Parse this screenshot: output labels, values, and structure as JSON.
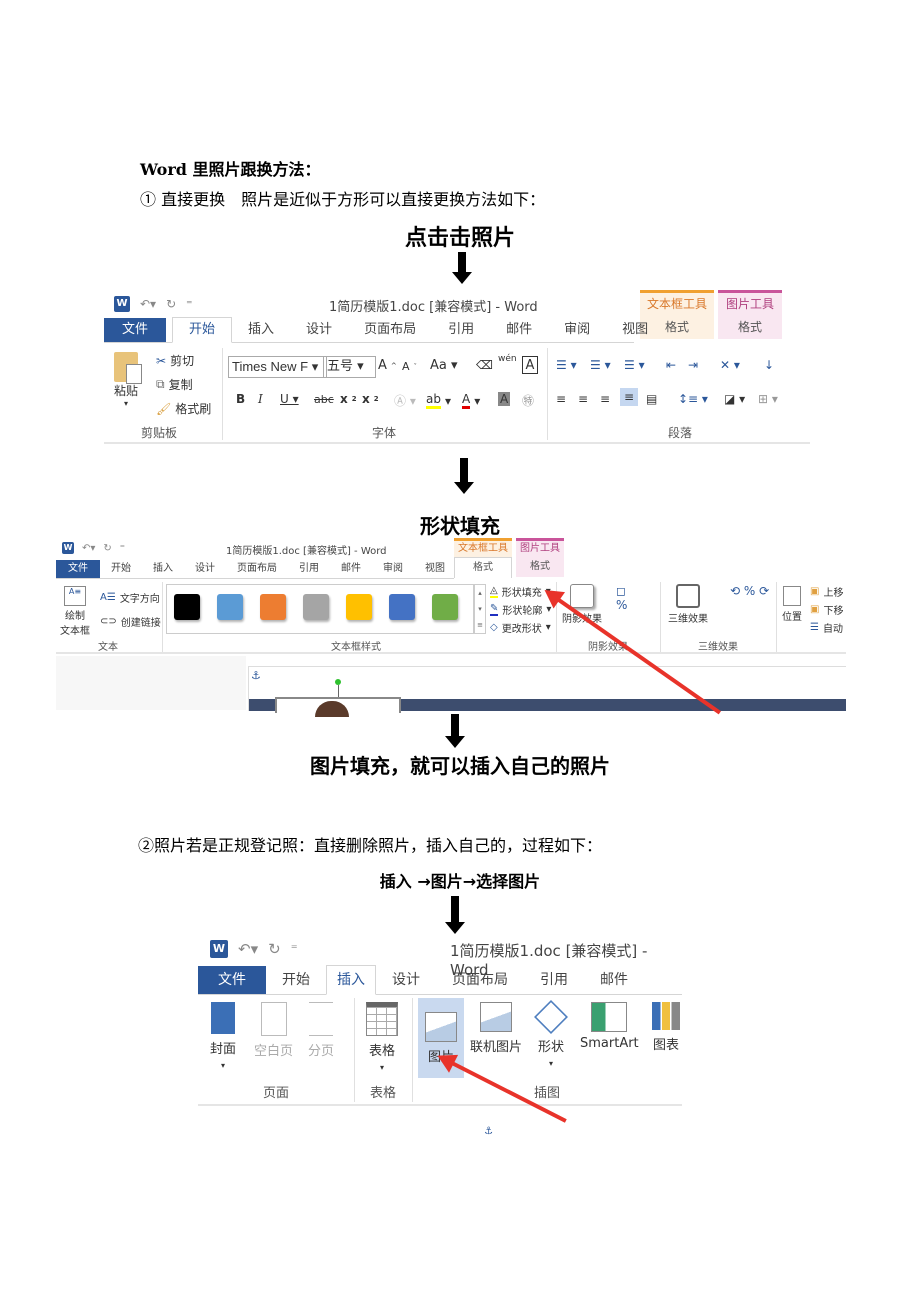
{
  "heading": "Word 里照片跟换方法：",
  "step1": {
    "num": "①",
    "text": "直接更换　照片是近似于方形可以直接更换方法如下：",
    "caption1": "点击击照片",
    "caption2": "形状填充",
    "caption3": "图片填充，就可以插入自己的照片"
  },
  "step2": {
    "text": "②照片若是正规登记照：直接删除照片，插入自己的，过程如下：",
    "caption": "插入 →图片→选择图片"
  },
  "ribbon1": {
    "title": "1简历模版1.doc [兼容模式] - Word",
    "tabs": [
      "文件",
      "开始",
      "插入",
      "设计",
      "页面布局",
      "引用",
      "邮件",
      "审阅",
      "视图"
    ],
    "context_tabs": [
      {
        "header": "文本框工具",
        "tab": "格式",
        "color": "#f0a030",
        "bg": "#fdf1e2"
      },
      {
        "header": "图片工具",
        "tab": "格式",
        "color": "#c9549a",
        "bg": "#f9e7f1"
      }
    ],
    "clipboard": {
      "paste": "粘贴",
      "cut": "剪切",
      "copy": "复制",
      "format_painter": "格式刷",
      "label": "剪贴板"
    },
    "font": {
      "font_name": "Times New F",
      "font_size": "五号",
      "label": "字体"
    },
    "paragraph": {
      "label": "段落"
    }
  },
  "ribbon2": {
    "title": "1简历模版1.doc [兼容模式] - Word",
    "tabs": [
      "文件",
      "开始",
      "插入",
      "设计",
      "页面布局",
      "引用",
      "邮件",
      "审阅",
      "视图"
    ],
    "context_tabs": [
      {
        "header": "文本框工具",
        "tab": "格式",
        "color": "#f0a030",
        "bg": "#fdf1e2"
      },
      {
        "header": "图片工具",
        "tab": "格式",
        "color": "#c9549a",
        "bg": "#f9e7f1"
      }
    ],
    "text_group": {
      "draw_textbox": "绘制\n文本框",
      "text_direction": "文字方向",
      "create_link": "创建链接",
      "label": "文本"
    },
    "styles_group": {
      "label": "文本框样式",
      "swatches": [
        "#000000",
        "#5b9bd5",
        "#ed7d31",
        "#a5a5a5",
        "#ffc000",
        "#4472c4",
        "#70ad47"
      ]
    },
    "shape_fill": "形状填充",
    "shape_outline": "形状轮廓",
    "change_shape": "更改形状",
    "shadow": "阴影效果",
    "shadow_label": "阴影效果",
    "threed": "三维效果",
    "threed_label": "三维效果",
    "position": "位置",
    "bring_forward": "上移",
    "send_backward": "下移",
    "auto": "自动"
  },
  "ribbon3": {
    "title": "1简历模版1.doc [兼容模式] - Word",
    "tabs": [
      "文件",
      "开始",
      "插入",
      "设计",
      "页面布局",
      "引用",
      "邮件"
    ],
    "buttons": [
      "封面",
      "空白页",
      "分页",
      "表格",
      "图片",
      "联机图片",
      "形状",
      "SmartArt",
      "图表"
    ],
    "groups": [
      "页面",
      "表格",
      "插图"
    ]
  }
}
